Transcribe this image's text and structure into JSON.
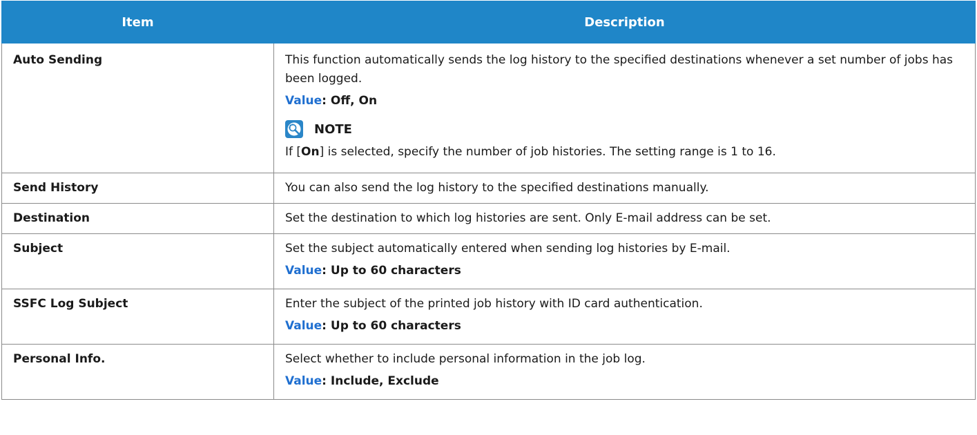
{
  "table": {
    "header_item": "Item",
    "header_description": "Description",
    "rows": [
      {
        "item": "Auto Sending",
        "description": "This function automatically sends the log history to the specified destinations whenever a set number of jobs has been logged.",
        "value_key": "Value",
        "value_text": ": Off, On",
        "note_label": "NOTE",
        "note_prefix": "If [",
        "note_bold": "On",
        "note_suffix": "] is selected, specify the number of job histories. The setting range is 1 to 16."
      },
      {
        "item": "Send History",
        "description": "You can also send the log history to the specified destinations manually."
      },
      {
        "item": "Destination",
        "description": "Set the destination to which log histories are sent. Only E-mail address can be set."
      },
      {
        "item": "Subject",
        "description": "Set the subject automatically entered when sending log histories by E-mail.",
        "value_key": "Value",
        "value_text": ": Up to 60 characters"
      },
      {
        "item": "SSFC Log Subject",
        "description": "Enter the subject of the printed job history with ID card authentication.",
        "value_key": "Value",
        "value_text": ": Up to 60 characters"
      },
      {
        "item": "Personal Info.",
        "description": "Select whether to include personal information in the job log.",
        "value_key": "Value",
        "value_text": ": Include, Exclude"
      }
    ]
  },
  "colors": {
    "header_bg": "#1f86c8",
    "value_key": "#1f6fd0",
    "border": "#8a8a8a"
  },
  "icons": {
    "note": "note-lightbulb-icon"
  }
}
